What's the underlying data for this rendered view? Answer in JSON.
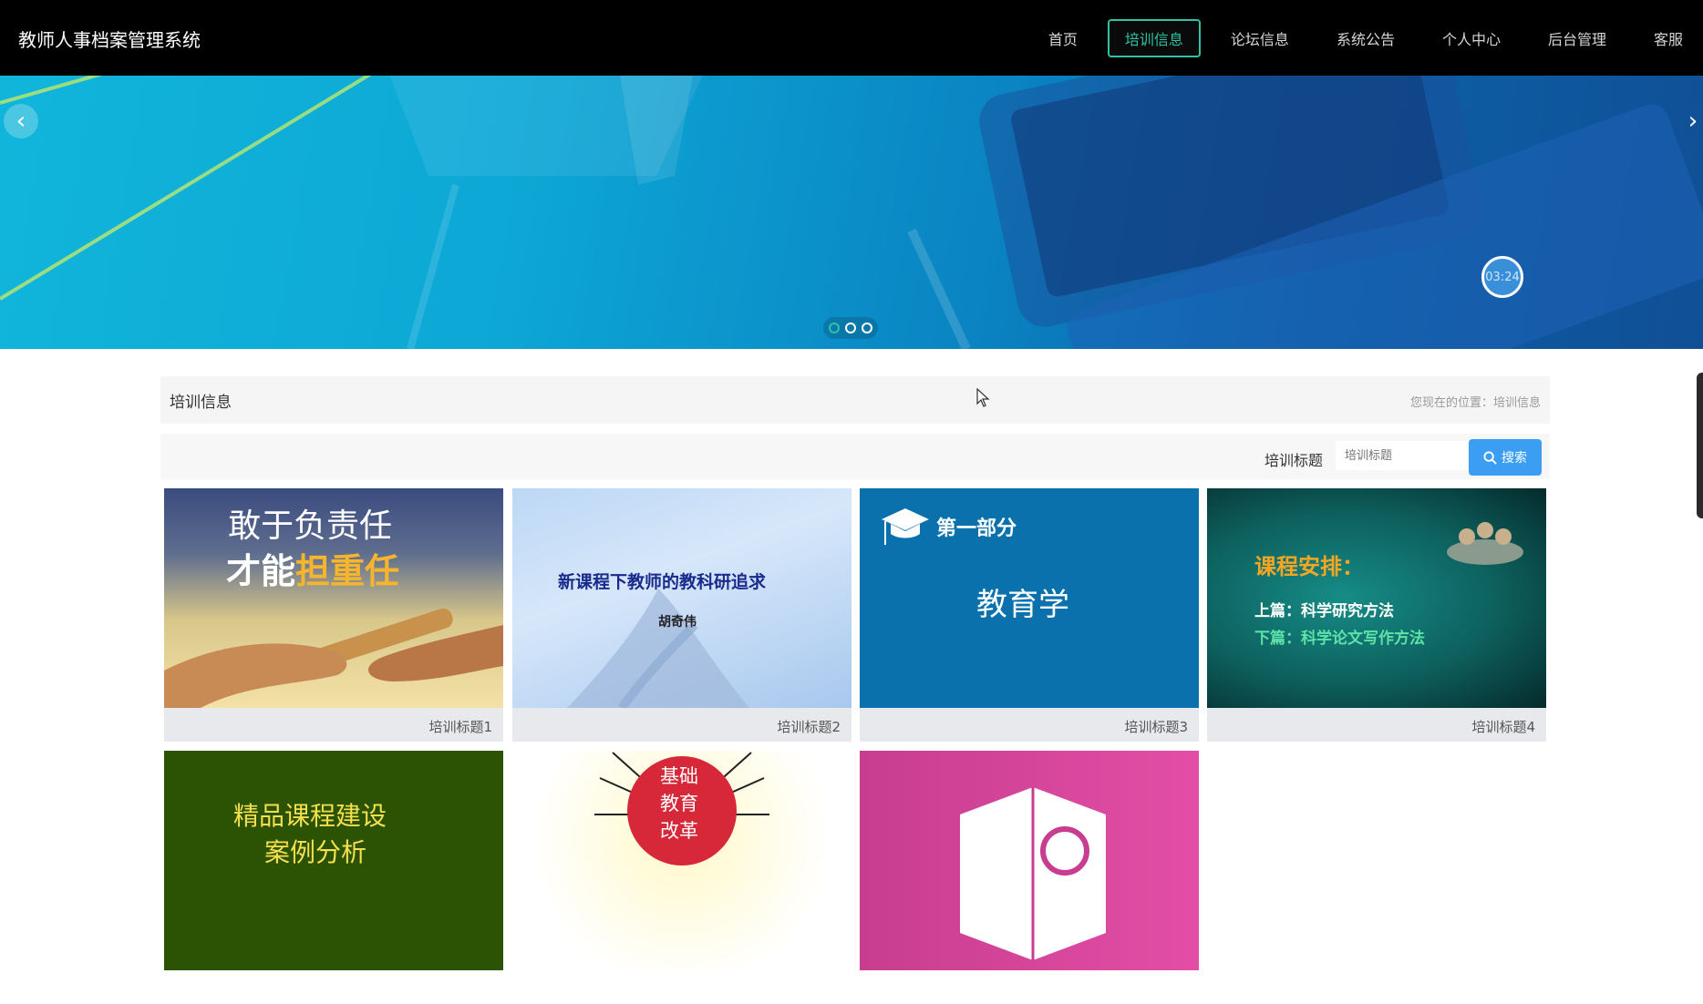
{
  "app": {
    "title": "教师人事档案管理系统"
  },
  "nav": {
    "items": [
      {
        "label": "首页",
        "active": false
      },
      {
        "label": "培训信息",
        "active": true
      },
      {
        "label": "论坛信息",
        "active": false
      },
      {
        "label": "系统公告",
        "active": false
      },
      {
        "label": "个人中心",
        "active": false
      },
      {
        "label": "后台管理",
        "active": false
      },
      {
        "label": "客服",
        "active": false
      }
    ]
  },
  "banner": {
    "prev_icon": "chevron-left-icon",
    "next_icon": "chevron-right-icon",
    "timer": "03:24",
    "active_slide": 1,
    "slide_count": 3
  },
  "section": {
    "title": "培训信息",
    "breadcrumb": "您现在的位置：培训信息"
  },
  "search": {
    "label": "培训标题",
    "placeholder": "培训标题",
    "button_label": "搜索"
  },
  "cards": [
    {
      "caption": "培训标题1",
      "image_line1": "敢于负责任",
      "image_line2_a": "才能",
      "image_line2_b": "担重任"
    },
    {
      "caption": "培训标题2",
      "image_line1": "新课程下教师的教科研追求",
      "image_line2": "胡奇伟"
    },
    {
      "caption": "培训标题3",
      "image_line1": "第一部分",
      "image_line2": "教育学"
    },
    {
      "caption": "培训标题4",
      "image_line1": "课程安排：",
      "image_line2": "上篇：科学研究方法",
      "image_line3": "下篇：科学论文写作方法"
    },
    {
      "caption": "",
      "image_line1": "精品课程建设",
      "image_line2": "案例分析"
    },
    {
      "caption": "",
      "image_line1": "基础",
      "image_line2": "教育",
      "image_line3": "改革"
    },
    {
      "caption": ""
    }
  ],
  "colors": {
    "accent": "#2fc2a6",
    "search_button": "#3c9ef2"
  }
}
